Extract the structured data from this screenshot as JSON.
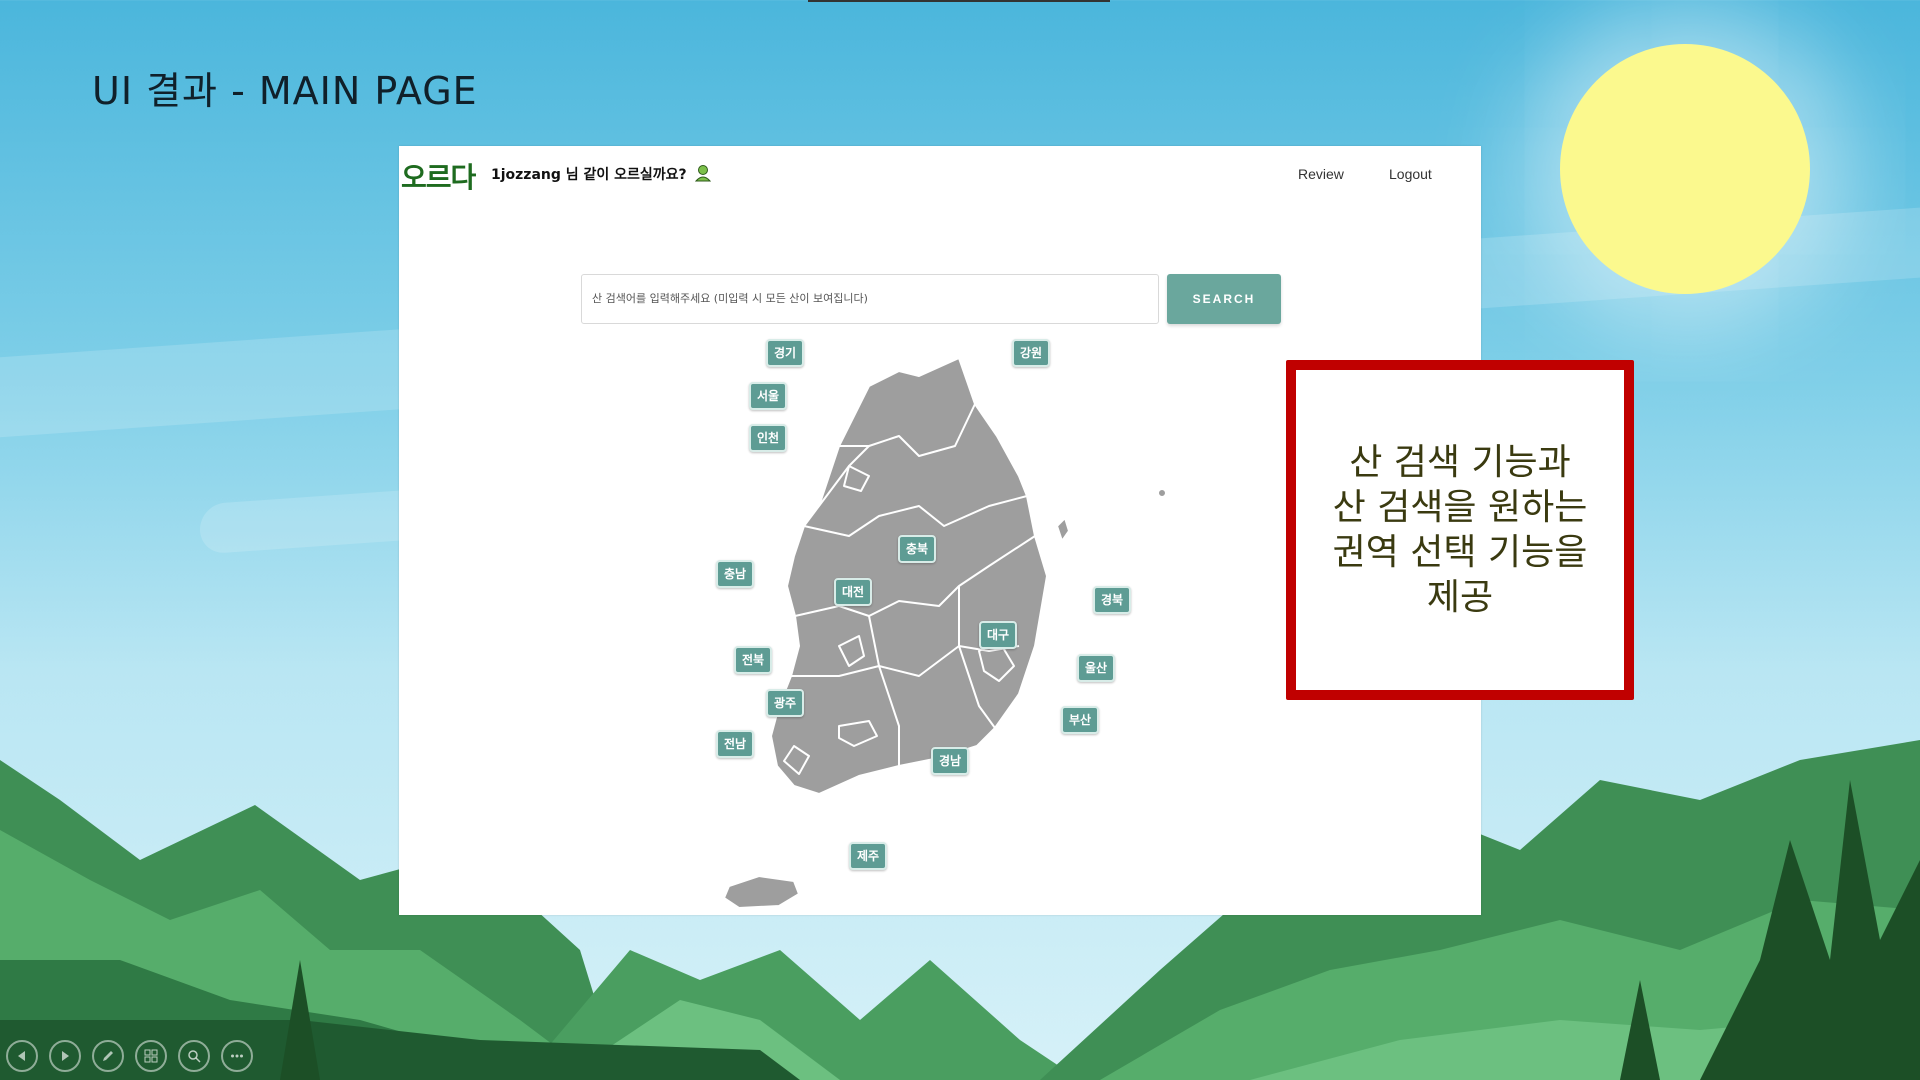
{
  "slide": {
    "title": "UI 결과 - MAIN PAGE",
    "callout_text": "산 검색 기능과\n산 검색을 원하는\n권역 선택 기능을\n제공"
  },
  "app": {
    "logo": "오르다",
    "greeting": "1jozzang 님 같이 오르실까요?",
    "nav": {
      "review": "Review",
      "logout": "Logout"
    },
    "search": {
      "placeholder": "산 검색어를 입력해주세요 (미입력 시 모든 산이 보여집니다)",
      "button": "SEARCH"
    },
    "regions": [
      "경기",
      "강원",
      "서울",
      "인천",
      "충북",
      "충남",
      "대전",
      "경북",
      "대구",
      "울산",
      "전북",
      "광주",
      "부산",
      "전남",
      "경남",
      "제주"
    ]
  },
  "toolbar": {
    "icons": [
      "prev-icon",
      "next-icon",
      "pen-icon",
      "slides-icon",
      "zoom-icon",
      "more-icon"
    ]
  },
  "colors": {
    "accent": "#6aa79d",
    "callout_border": "#c00000",
    "logo": "#1e6b1f",
    "sun": "#fbf98e"
  }
}
